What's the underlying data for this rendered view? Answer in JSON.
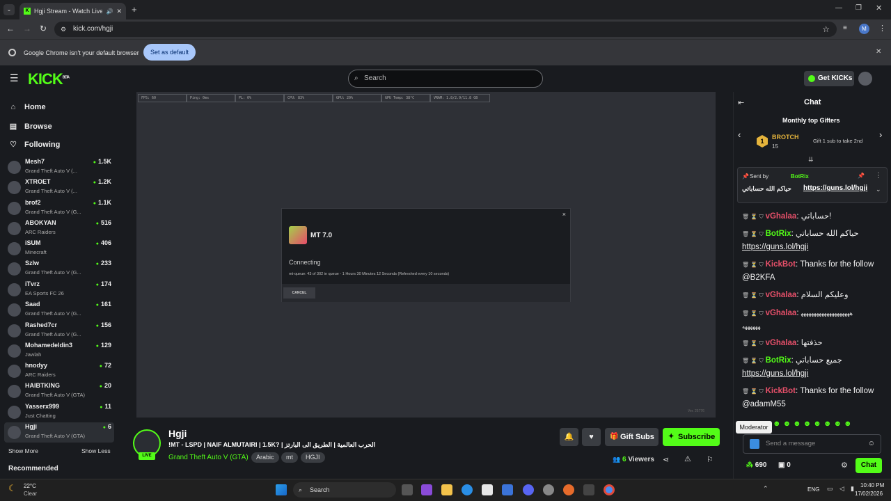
{
  "browser": {
    "tab_title": "Hgji Stream - Watch Live o",
    "url": "kick.com/hgji",
    "profile_initial": "M",
    "infobar_text": "Google Chrome isn't your default browser",
    "set_default_label": "Set as default"
  },
  "header": {
    "logo": "KICK",
    "logo_badge": "BETA",
    "search_placeholder": "Search",
    "get_kicks_label": "Get KICKs"
  },
  "sidebar": {
    "nav": [
      {
        "label": "Home",
        "icon": "home-icon"
      },
      {
        "label": "Browse",
        "icon": "browse-icon"
      },
      {
        "label": "Following",
        "icon": "heart-icon"
      }
    ],
    "channels": [
      {
        "name": "Mesh7",
        "game": "Grand Theft Auto V (...",
        "viewers": "1.5K"
      },
      {
        "name": "XTROET",
        "game": "Grand Theft Auto V (...",
        "viewers": "1.2K"
      },
      {
        "name": "brof2",
        "game": "Grand Theft Auto V (G...",
        "viewers": "1.1K"
      },
      {
        "name": "ABOKYAN",
        "game": "ARC Raiders",
        "viewers": "516"
      },
      {
        "name": "iSUM",
        "game": "Minecraft",
        "viewers": "406"
      },
      {
        "name": "Szlw",
        "game": "Grand Theft Auto V (G...",
        "viewers": "233"
      },
      {
        "name": "iTvrz",
        "game": "EA Sports FC 26",
        "viewers": "174"
      },
      {
        "name": "Saad",
        "game": "Grand Theft Auto V (G...",
        "viewers": "161"
      },
      {
        "name": "Rashed7cr",
        "game": "Grand Theft Auto V (G...",
        "viewers": "156"
      },
      {
        "name": "Mohamedeldin3",
        "game": "Jawlah",
        "viewers": "129"
      },
      {
        "name": "hnodyy",
        "game": "ARC Raiders",
        "viewers": "72"
      },
      {
        "name": "HAIBTKING",
        "game": "Grand Theft Auto V (GTA)",
        "viewers": "20"
      },
      {
        "name": "Yasserx999",
        "game": "Just Chatting",
        "viewers": "11"
      },
      {
        "name": "Hgji",
        "game": "Grand Theft Auto V (GTA)",
        "viewers": "6"
      }
    ],
    "show_more": "Show More",
    "show_less": "Show Less",
    "recommended": "Recommended"
  },
  "video": {
    "stats": [
      "FPS: 60",
      "Ping: 0ms",
      "PL: 0%",
      "CPU: 83%",
      "GPU: 20%",
      "GPU Temp: 38°C",
      "VRAM: 1.8/2.9/11.8 GB"
    ],
    "dialog": {
      "app_name": "MT 7.0",
      "status": "Connecting",
      "queue_text": "mt-queue: 43 of 302 in queue - 1 Hours 30 Minutes 12 Seconds (Refreshed every 10 seconds)",
      "cancel_label": "CANCEL",
      "close": "×"
    },
    "version": "Ver. 25776"
  },
  "stream": {
    "streamer": "Hgji",
    "live_badge": "LIVE",
    "title": "!MT  - LSPD | NAIF ALMUTAIRI | 1.5K? | الحرب العالمية | الطريق الى البارتز",
    "game": "Grand Theft Auto V (GTA)",
    "tags": [
      "Arabic",
      "mt",
      "HGJI"
    ],
    "gift_subs_label": "Gift Subs",
    "subscribe_label": "Subscribe",
    "viewers_count": "6",
    "viewers_label": "Viewers"
  },
  "chat": {
    "title": "Chat",
    "top_gifters_title": "Monthly top Gifters",
    "gifter_rank": "1",
    "gifter_name": "BROTCH",
    "gifter_count": "15",
    "gift_tip": "Gift 1 sub to take 2nd",
    "pinned": {
      "sent_by_label": "Sent by",
      "sender": "BotRix",
      "text": "حياكم الله حساباتي",
      "link": "https://guns.lol/hgji"
    },
    "messages": [
      {
        "user": "vGhalaa",
        "color": "#e8506a",
        "text": "حساباتي!"
      },
      {
        "user": "BotRix",
        "color": "#53fc18",
        "text": "حياكم الله حساباتي",
        "link": "https://guns.lol/hgji"
      },
      {
        "user": "KickBot",
        "color": "#e8506a",
        "text": "Thanks for the follow @B2KFA"
      },
      {
        "user": "vGhalaa",
        "color": "#e8506a",
        "text": "وعليكم السلام"
      },
      {
        "user": "vGhalaa",
        "color": "#e8506a",
        "text": "ههههههههههههههههههههههههههه"
      },
      {
        "user": "vGhalaa",
        "color": "#e8506a",
        "text": "حذفتها"
      },
      {
        "user": "BotRix",
        "color": "#53fc18",
        "text": "جميع حساباتي",
        "link": "https://guns.lol/hgji"
      },
      {
        "user": "KickBot",
        "color": "#e8506a",
        "text": "Thanks for the follow @adamM55"
      }
    ],
    "tooltip": "Moderator",
    "input_placeholder": "Send a message",
    "points": "690",
    "gifts_count": "0",
    "chat_button": "Chat"
  },
  "taskbar": {
    "weather_temp": "22°C",
    "weather_desc": "Clear",
    "search_label": "Search",
    "lang": "ENG",
    "time": "10:40 PM",
    "date": "17/02/2026"
  },
  "colors": {
    "accent": "#53fc18",
    "background": "#191b1f",
    "video_bg": "#2e3036"
  }
}
